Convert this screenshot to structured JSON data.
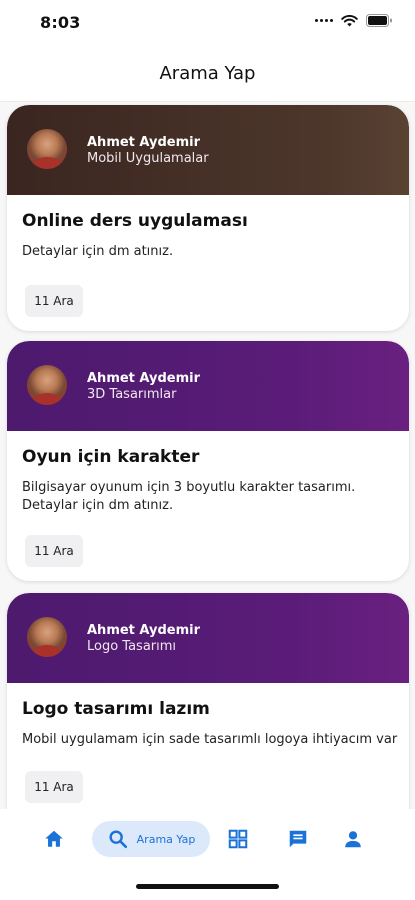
{
  "status_bar": {
    "time": "8:03"
  },
  "header": {
    "title": "Arama Yap"
  },
  "posts": [
    {
      "author": "Ahmet Aydemir",
      "category": "Mobil Uygulamalar",
      "title": "Online ders uygulaması",
      "description": "Detaylar için dm atınız.",
      "date": "11 Ara",
      "theme": "brown"
    },
    {
      "author": "Ahmet Aydemir",
      "category": "3D Tasarımlar",
      "title": "Oyun için karakter",
      "description": "Bilgisayar oyunum için 3 boyutlu karakter tasarımı.\nDetaylar için dm atınız.",
      "date": "11 Ara",
      "theme": "purple"
    },
    {
      "author": "Ahmet Aydemir",
      "category": "Logo Tasarımı",
      "title": "Logo tasarımı lazım",
      "description": "Mobil uygulamam için sade tasarımlı logoya ihtiyacım var",
      "date": "11 Ara",
      "theme": "purple"
    }
  ],
  "bottom_nav": {
    "search_label": "Arama Yap",
    "items": [
      "home-icon",
      "search-icon",
      "grid-icon",
      "chat-icon",
      "profile-icon"
    ],
    "accent": "#1a72d9",
    "active_bg": "#dbe9fb"
  },
  "colors": {
    "card_brown": "#3a2520",
    "card_purple": "#5a1c78"
  }
}
